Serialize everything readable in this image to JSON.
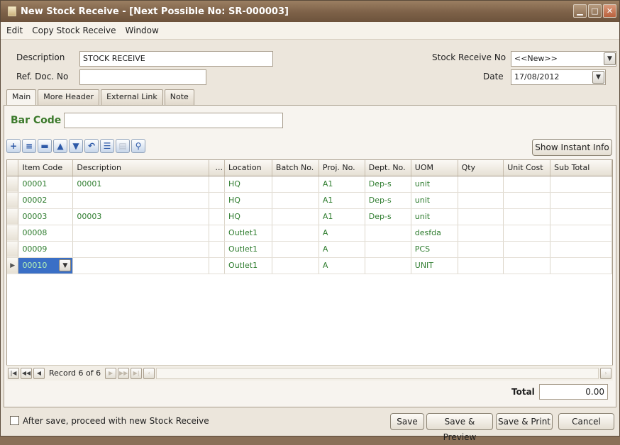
{
  "window": {
    "title": "New Stock Receive - [Next Possible No: SR-000003]"
  },
  "menu": [
    "Edit",
    "Copy Stock Receive",
    "Window"
  ],
  "header": {
    "description_label": "Description",
    "description_value": "STOCK RECEIVE",
    "ref_doc_label": "Ref. Doc. No",
    "ref_doc_value": "",
    "stock_receive_no_label": "Stock Receive No",
    "stock_receive_no_value": "<<New>>",
    "date_label": "Date",
    "date_value": "17/08/2012"
  },
  "tabs": [
    "Main",
    "More Header",
    "External Link",
    "Note"
  ],
  "barcode": {
    "label": "Bar Code",
    "value": ""
  },
  "toolbar": {
    "show_instant_info": "Show Instant Info"
  },
  "grid": {
    "columns": [
      "Item Code",
      "Description",
      "...",
      "Location",
      "Batch No.",
      "Proj. No.",
      "Dept. No.",
      "UOM",
      "Qty",
      "Unit Cost",
      "Sub Total"
    ],
    "rows": [
      [
        "00001",
        "00001",
        "",
        "HQ",
        "",
        "A1",
        "Dep-s",
        "unit",
        "",
        "",
        ""
      ],
      [
        "00002",
        "",
        "",
        "HQ",
        "",
        "A1",
        "Dep-s",
        "unit",
        "",
        "",
        ""
      ],
      [
        "00003",
        "00003",
        "",
        "HQ",
        "",
        "A1",
        "Dep-s",
        "unit",
        "",
        "",
        ""
      ],
      [
        "00008",
        "",
        "",
        "Outlet1",
        "",
        "A",
        "",
        "desfda",
        "",
        "",
        ""
      ],
      [
        "00009",
        "",
        "",
        "Outlet1",
        "",
        "A",
        "",
        "PCS",
        "",
        "",
        ""
      ],
      [
        "00010",
        "",
        "",
        "Outlet1",
        "",
        "A",
        "",
        "UNIT",
        "",
        "",
        ""
      ]
    ],
    "record_text": "Record 6 of 6"
  },
  "total": {
    "label": "Total",
    "value": "0.00"
  },
  "footer": {
    "proceed_label": "After save, proceed with new Stock Receive",
    "save": "Save",
    "save_preview": "Save & Preview",
    "save_print": "Save & Print",
    "cancel": "Cancel"
  },
  "colors": {
    "title_bar": "#7d6148",
    "cell_text": "#2f7d2f",
    "barcode_label": "#3c7a2c",
    "selection": "#3a6fc6"
  }
}
